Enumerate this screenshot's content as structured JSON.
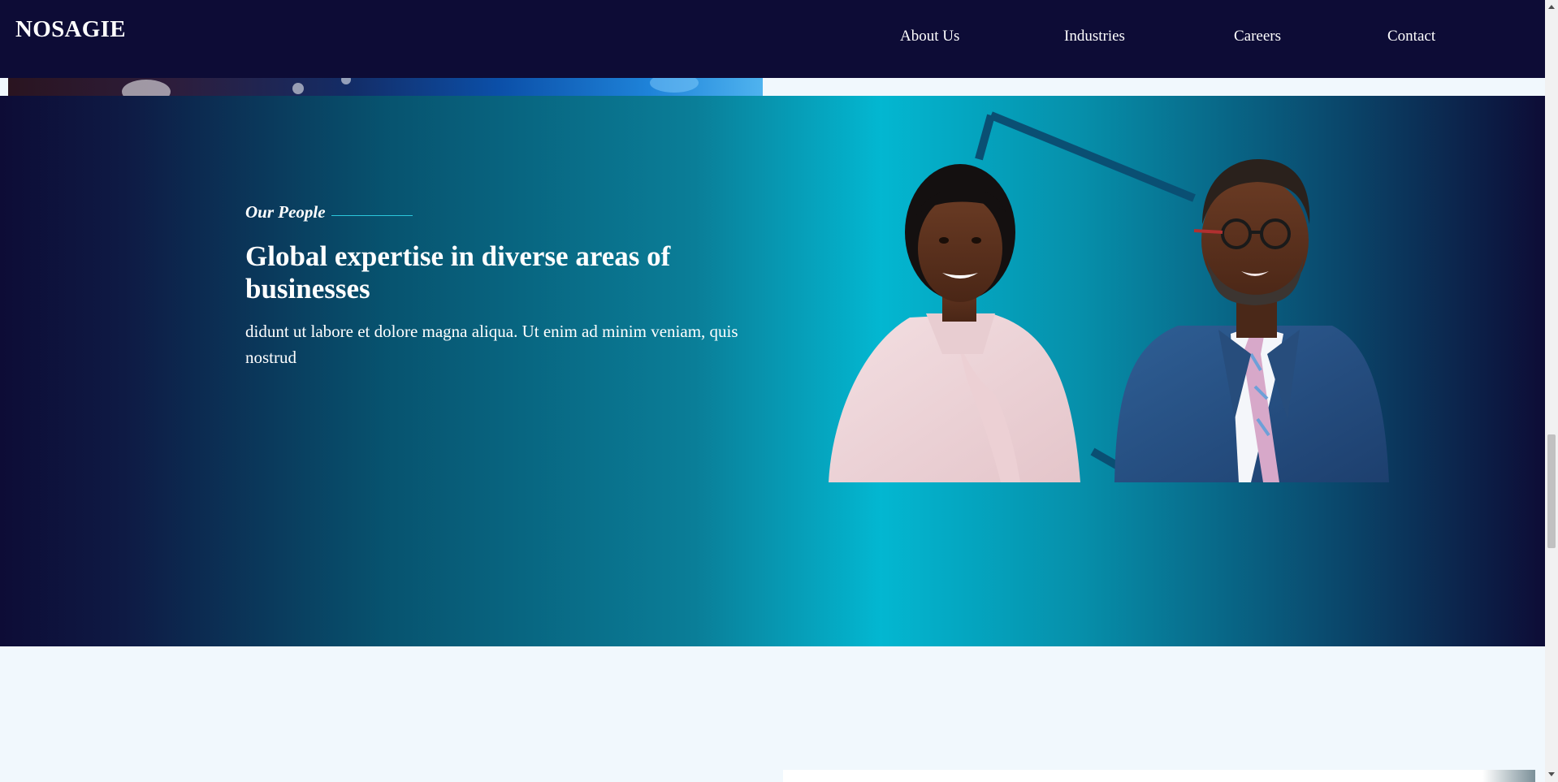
{
  "header": {
    "brand": "NOSAGIE",
    "nav": [
      {
        "label": "About Us"
      },
      {
        "label": "Industries"
      },
      {
        "label": "Careers"
      },
      {
        "label": "Contact"
      }
    ]
  },
  "people_section": {
    "eyebrow": "Our People",
    "headline": "Global expertise in diverse areas of businesses",
    "body": "didunt ut labore et dolore magna aliqua. Ut enim ad minim veniam, quis nostrud"
  },
  "colors": {
    "navy": "#0d0c36",
    "teal_accent": "#03b7d1",
    "page_background": "#f1f8fd"
  }
}
